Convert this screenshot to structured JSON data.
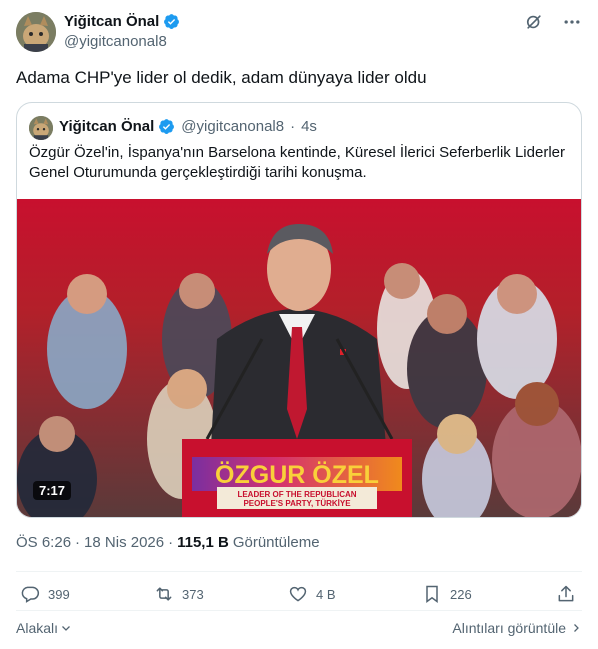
{
  "author": {
    "name": "Yiğitcan Önal",
    "handle": "@yigitcanonal8"
  },
  "tweet": {
    "text": "Adama CHP'ye lider ol dedik, adam dünyaya lider oldu"
  },
  "quoted": {
    "name": "Yiğitcan Önal",
    "handle": "@yigitcanonal8",
    "separator": "·",
    "time": "4s",
    "text": "Özgür Özel'in, İspanya'nın Barselona kentinde, Küresel İlerici Seferberlik Liderler Genel Oturumunda gerçekleştirdiği tarihi konuşma.",
    "video": {
      "duration": "7:17",
      "podium_title": "ÖZGUR ÖZEL",
      "podium_line1": "LEADER OF THE REPUBLICAN",
      "podium_line2": "PEOPLE'S PARTY, TÜRKİYE"
    }
  },
  "meta": {
    "time": "ÖS 6:26",
    "dot": "·",
    "date": "18 Nis 2026",
    "views_count": "115,1 B",
    "views_label": "Görüntüleme"
  },
  "actions": {
    "replies": "399",
    "reposts": "373",
    "likes": "4 B",
    "bookmarks": "226"
  },
  "footer": {
    "related": "Alakalı",
    "quotes": "Alıntıları görüntüle"
  },
  "colors": {
    "verified": "#1d9bf0",
    "text_secondary": "#536471",
    "stage_red": "#c8102e"
  }
}
